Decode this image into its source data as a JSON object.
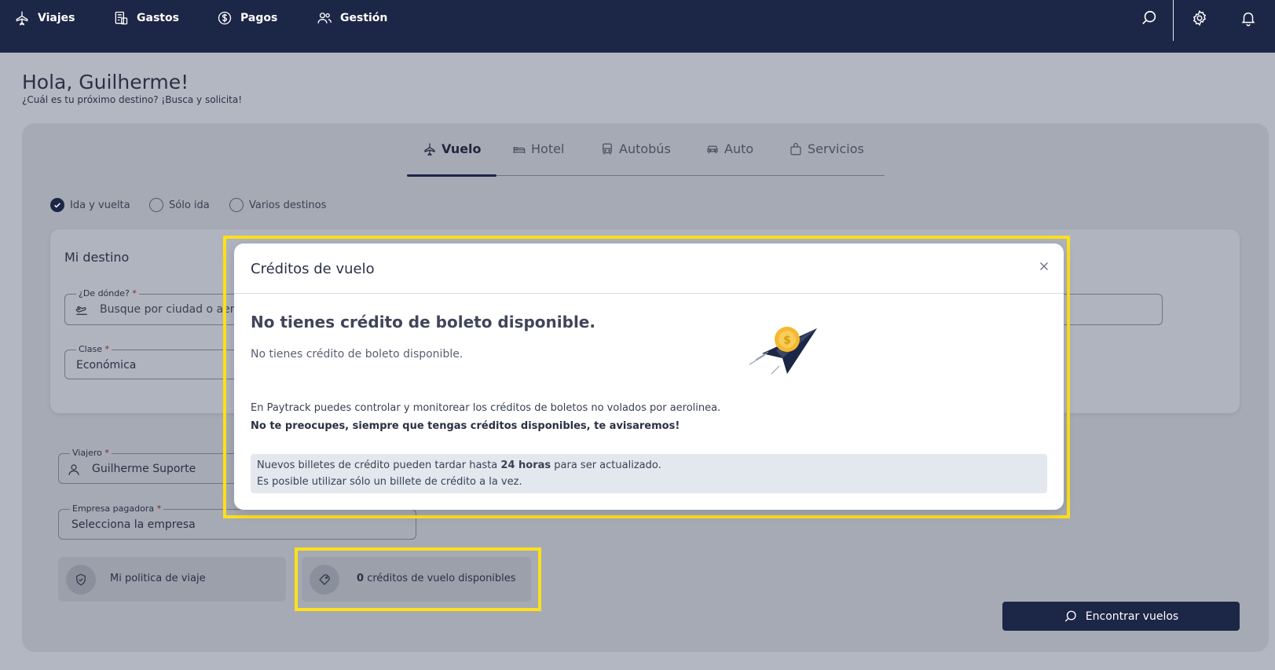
{
  "nav": {
    "items": [
      {
        "label": "Viajes",
        "icon": "plane-icon"
      },
      {
        "label": "Gastos",
        "icon": "receipt-icon"
      },
      {
        "label": "Pagos",
        "icon": "dollar-icon"
      },
      {
        "label": "Gestión",
        "icon": "users-icon"
      }
    ],
    "right_icons": [
      "search-icon",
      "gear-icon",
      "bell-icon"
    ]
  },
  "greeting": {
    "title": "Hola, Guilherme!",
    "subtitle": "¿Cuál es tu próximo destino? ¡Busca y solicita!"
  },
  "tabs": [
    {
      "label": "Vuelo",
      "icon": "plane-icon",
      "active": true
    },
    {
      "label": "Hotel",
      "icon": "bed-icon",
      "active": false
    },
    {
      "label": "Autobús",
      "icon": "bus-icon",
      "active": false
    },
    {
      "label": "Auto",
      "icon": "car-icon",
      "active": false
    },
    {
      "label": "Servicios",
      "icon": "bag-icon",
      "active": false
    }
  ],
  "trip_types": [
    {
      "label": "Ida y vuelta",
      "checked": true
    },
    {
      "label": "Sólo ida",
      "checked": false
    },
    {
      "label": "Varios destinos",
      "checked": false
    }
  ],
  "destination": {
    "title": "Mi destino",
    "from_label": "¿De dónde?",
    "from_placeholder": "Busque por ciudad o aer",
    "class_label": "Clase",
    "class_value": "Económica",
    "required_mark": "*"
  },
  "traveler": {
    "label": "Viajero",
    "value": "Guilherme Suporte"
  },
  "company": {
    "label": "Empresa pagadora",
    "placeholder": "Selecciona la empresa"
  },
  "policy": {
    "label": "Mi politica de viaje"
  },
  "credits": {
    "count": "0",
    "label": "créditos de vuelo disponibles"
  },
  "find_button": {
    "label": "Encontrar vuelos"
  },
  "modal": {
    "title": "Créditos de vuelo",
    "heading": "No tienes crédito de boleto disponible.",
    "subtext": "No tienes crédito de boleto disponible.",
    "paragraph1": "En Paytrack puedes controlar y monitorear los créditos de boletos no volados por aerolinea.",
    "paragraph2": "No te preocupes, siempre que tengas créditos disponibles, te avisaremos!",
    "note_line1_pre": "Nuevos billetes de crédito pueden tardar hasta ",
    "note_line1_bold": "24 horas",
    "note_line1_post": " para ser actualizado.",
    "note_line2": "Es posible utilizar sólo un billete de crédito a la vez."
  },
  "colors": {
    "nav_bg": "#1c2646",
    "highlight": "#ffe01a",
    "accent_coin": "#f5b82e"
  }
}
